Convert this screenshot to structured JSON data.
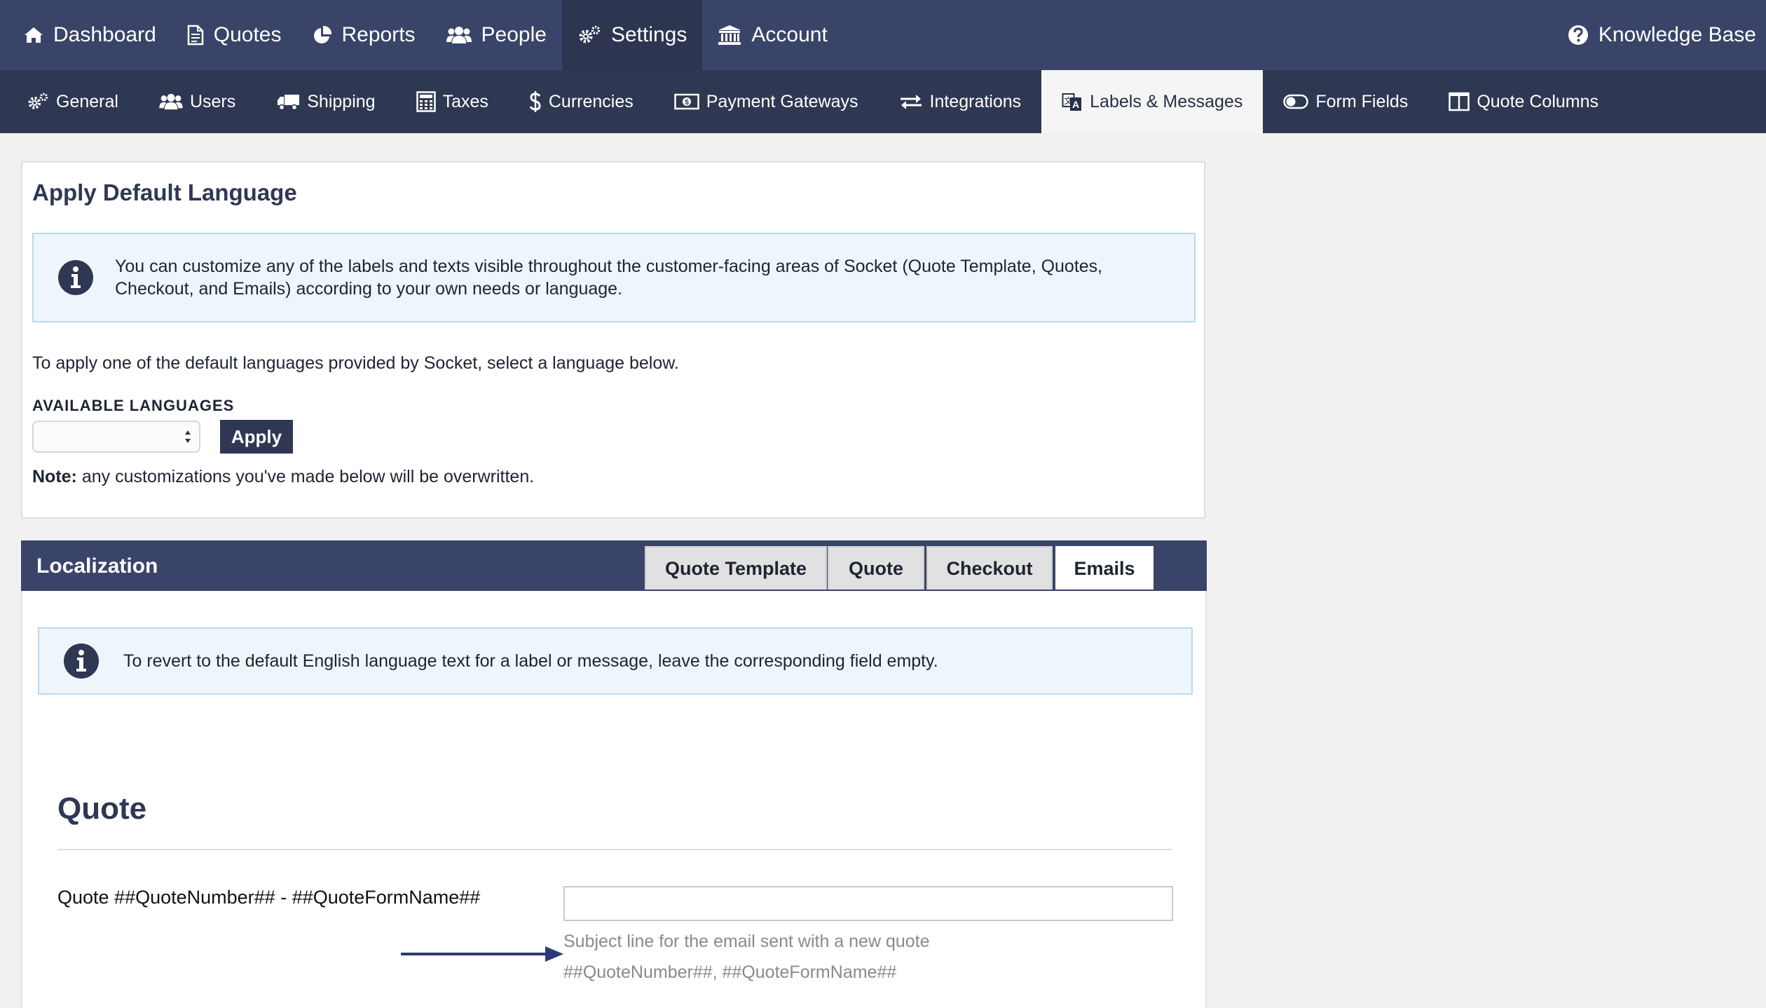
{
  "topnav": {
    "items": [
      {
        "label": "Dashboard",
        "icon": "home-icon"
      },
      {
        "label": "Quotes",
        "icon": "document-icon"
      },
      {
        "label": "Reports",
        "icon": "pie-chart-icon"
      },
      {
        "label": "People",
        "icon": "people-icon"
      },
      {
        "label": "Settings",
        "icon": "gears-icon",
        "active": true
      },
      {
        "label": "Account",
        "icon": "bank-icon"
      }
    ],
    "knowledge_base": "Knowledge Base"
  },
  "subnav": {
    "items": [
      {
        "label": "General",
        "icon": "gears-icon"
      },
      {
        "label": "Users",
        "icon": "users-icon"
      },
      {
        "label": "Shipping",
        "icon": "truck-icon"
      },
      {
        "label": "Taxes",
        "icon": "calculator-icon"
      },
      {
        "label": "Currencies",
        "icon": "dollar-icon"
      },
      {
        "label": "Payment Gateways",
        "icon": "money-icon"
      },
      {
        "label": "Integrations",
        "icon": "exchange-icon"
      },
      {
        "label": "Labels & Messages",
        "icon": "language-icon",
        "active": true
      },
      {
        "label": "Form Fields",
        "icon": "toggle-icon"
      },
      {
        "label": "Quote Columns",
        "icon": "columns-icon"
      }
    ]
  },
  "default_language": {
    "title": "Apply Default Language",
    "info": "You can customize any of the labels and texts visible throughout the customer-facing areas of Socket (Quote Template, Quotes, Checkout, and Emails) according to your own needs or language.",
    "lead": "To apply one of the default languages provided by Socket, select a language below.",
    "languages_label": "AVAILABLE LANGUAGES",
    "selected_language": "",
    "apply_label": "Apply",
    "note_bold": "Note:",
    "note_text": " any customizations you've made below will be overwritten."
  },
  "localization": {
    "title": "Localization",
    "tabs": [
      {
        "label": "Quote Template"
      },
      {
        "label": "Quote"
      },
      {
        "label": "Checkout"
      },
      {
        "label": "Emails",
        "active": true
      }
    ],
    "info": "To revert to the default English language text for a label or message, leave the corresponding field empty.",
    "section_title": "Quote",
    "field_label": "Quote ##QuoteNumber## - ##QuoteFormName##",
    "field_value": "",
    "help_text": "Subject line for the email sent with a new quote",
    "help_vars": "##QuoteNumber##, ##QuoteFormName##"
  },
  "colors": {
    "nav_bg": "#3a4468",
    "subnav_bg": "#2f3852",
    "info_bg": "#eef6fc",
    "arrow": "#2b3a78"
  }
}
